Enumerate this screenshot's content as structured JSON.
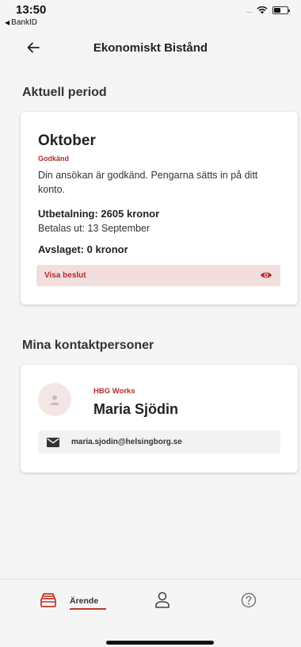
{
  "status_bar": {
    "time": "13:50",
    "back_app": "BankID",
    "signal": "....."
  },
  "header": {
    "title": "Ekonomiskt Bistånd"
  },
  "current_period": {
    "section_title": "Aktuell period",
    "month": "Oktober",
    "status": "Godkänd",
    "message": "Din ansökan är godkänd. Pengarna sätts in på ditt konto.",
    "payout": "Utbetalning: 2605 kronor",
    "payout_date": "Betalas ut: 13 September",
    "rejected": "Avslaget: 0 kronor",
    "decision_button": "Visa beslut"
  },
  "contacts": {
    "section_title": "Mina kontaktpersoner",
    "items": [
      {
        "organization": "HBG Works",
        "name": "Maria Sjödin",
        "email": "maria.sjodin@helsingborg.se"
      }
    ]
  },
  "tab_bar": {
    "tabs": [
      {
        "label": "Ärende",
        "icon": "inbox-icon",
        "active": true
      },
      {
        "label": "",
        "icon": "profile-icon",
        "active": false
      },
      {
        "label": "",
        "icon": "help-icon",
        "active": false
      }
    ]
  },
  "colors": {
    "accent": "#b42b2b",
    "accent_light": "#f3dede",
    "background": "#f5f5f5",
    "card": "#ffffff"
  }
}
